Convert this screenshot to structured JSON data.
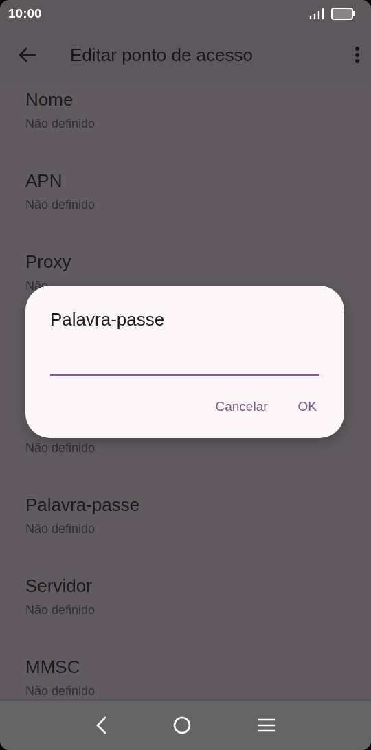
{
  "status_bar": {
    "time": "10:00"
  },
  "toolbar": {
    "title": "Editar ponto de acesso"
  },
  "rows": [
    {
      "title": "Nome",
      "subtitle": "Não definido"
    },
    {
      "title": "APN",
      "subtitle": "Não definido"
    },
    {
      "title": "Proxy",
      "subtitle": "Não"
    },
    {
      "covered": true
    },
    {
      "subtitle": "Não definido"
    },
    {
      "title": "Palavra-passe",
      "subtitle": "Não definido"
    },
    {
      "title": "Servidor",
      "subtitle": "Não definido"
    },
    {
      "title": "MMSC",
      "subtitle": "Não definido"
    }
  ],
  "dialog": {
    "title": "Palavra-passe",
    "field": {
      "focused": true
    },
    "buttons": [
      "Cancelar",
      "OK"
    ]
  }
}
